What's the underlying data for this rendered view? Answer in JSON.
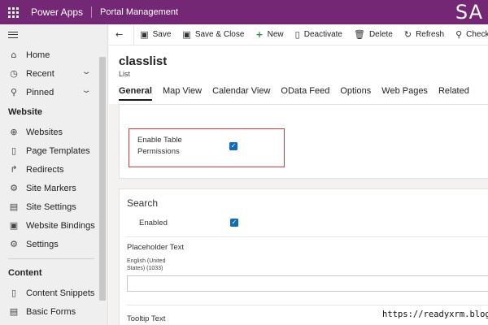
{
  "topbar": {
    "app_name": "Power Apps",
    "portal_name": "Portal Management",
    "user_initials": "SA",
    "accent_color": "#742774"
  },
  "sidebar": {
    "items": [
      {
        "label": "Home",
        "icon": "home-icon"
      },
      {
        "label": "Recent",
        "icon": "clock-icon"
      },
      {
        "label": "Pinned",
        "icon": "pin-icon"
      }
    ],
    "sections": [
      {
        "title": "Website",
        "items": [
          {
            "label": "Websites",
            "icon": "globe-icon"
          },
          {
            "label": "Page Templates",
            "icon": "page-icon"
          },
          {
            "label": "Redirects",
            "icon": "redirect-icon"
          },
          {
            "label": "Site Markers",
            "icon": "marker-icon"
          },
          {
            "label": "Site Settings",
            "icon": "site-settings-icon"
          },
          {
            "label": "Website Bindings",
            "icon": "binding-icon"
          },
          {
            "label": "Settings",
            "icon": "gear-icon"
          }
        ]
      },
      {
        "title": "Content",
        "items": [
          {
            "label": "Content Snippets",
            "icon": "snippet-icon"
          },
          {
            "label": "Basic Forms",
            "icon": "form-icon"
          }
        ]
      }
    ]
  },
  "commandbar": {
    "save": "Save",
    "save_close": "Save & Close",
    "new": "New",
    "deactivate": "Deactivate",
    "delete": "Delete",
    "refresh": "Refresh",
    "check_access": "Check Acce"
  },
  "record": {
    "title": "classlist",
    "entity": "List"
  },
  "tabs": [
    "General",
    "Map View",
    "Calendar View",
    "OData Feed",
    "Options",
    "Web Pages",
    "Related"
  ],
  "form": {
    "enable_table_permissions_line1": "Enable Table",
    "enable_table_permissions_line2": "Permissions",
    "enable_table_permissions_checked": true,
    "search_section_title": "Search",
    "enabled_label": "Enabled",
    "enabled_checked": true,
    "placeholder_label": "Placeholder Text",
    "placeholder_lang_line1": "English (United",
    "placeholder_lang_line2": "States) (1033)",
    "placeholder_value": "",
    "tooltip_label": "Tooltip Text"
  },
  "watermark": "https://readyxrm.blog"
}
